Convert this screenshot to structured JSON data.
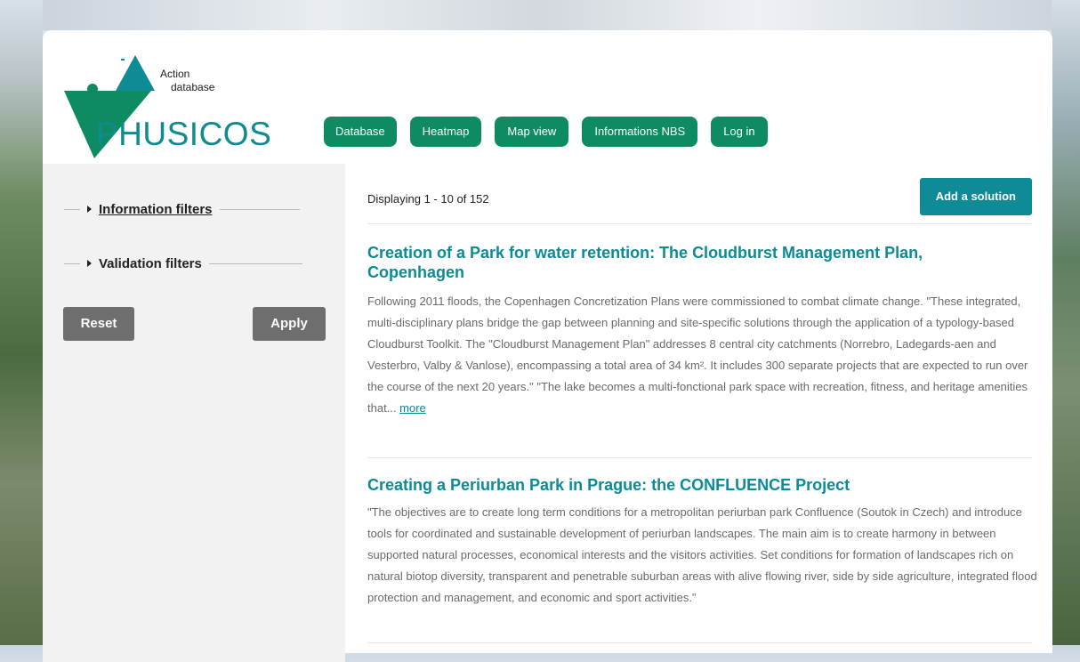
{
  "logo": {
    "line1": "Action",
    "line2": "database",
    "wordmark": "PHUSICOS"
  },
  "nav": [
    "Database",
    "Heatmap",
    "Map view",
    "Informations NBS",
    "Log in"
  ],
  "sidebar": {
    "information_filters": "Information filters",
    "validation_filters": "Validation filters",
    "reset": "Reset",
    "apply": "Apply"
  },
  "main": {
    "count_text": "Displaying 1 - 10 of 152",
    "add_solution": "Add a solution",
    "items": [
      {
        "title": "Creation of a Park for water retention: The Cloudburst Management Plan, Copenhagen",
        "body": "Following 2011 floods, the Copenhagen Concretization Plans were commissioned to combat climate change. \"These integrated, multi-disciplinary plans bridge the gap between planning and site-specific solutions through the application of a typology-based Cloudburst Toolkit. The \"Cloudburst Management Plan\" addresses 8 central city catchments (Norrebro, Ladegards-aen and Vesterbro, Valby & Vanlose), encompassing a total area of 34 km². It includes 300 separate projects that are expected to run over the course of the next 20 years.\" \"The lake becomes a multi-fonctional park space with recreation, fitness, and heritage amenities that...",
        "more": "more"
      },
      {
        "title": "Creating a Periurban Park in Prague: the CONFLUENCE Project",
        "body": "\"The objectives are to create long term conditions for a metropolitan periurban park Confluence (Soutok in Czech) and introduce tools for coordinated and sustainable development of periurban landscapes. The main aim is to create harmony in between supported natural processes, economical interests and the visitors activities. Set conditions for formation of landscapes rich on natural biotop diversity, transparent and penetrable suburban areas with alive flowing river, side by side agriculture, integrated flood protection and management, and economic and sport activities.\""
      }
    ]
  },
  "colors": {
    "nav_green": "#0f8b63",
    "teal": "#0b8b96",
    "button_gray": "#6e6e6e",
    "sidebar_bg": "#f2f2f2"
  }
}
